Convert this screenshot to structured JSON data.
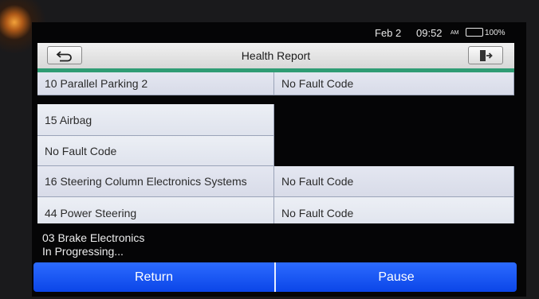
{
  "status_bar": {
    "date": "Feb 2",
    "time": "09:52",
    "ampm": "AM",
    "battery_percent": "100%",
    "battery_level": 1.0
  },
  "header": {
    "title": "Health Report",
    "back_icon": "back-arrow-icon",
    "exit_icon": "exit-door-icon",
    "accent_color": "#2f9c74"
  },
  "report": {
    "row_10": {
      "module": "10 Parallel Parking 2",
      "status": "No Fault Code"
    },
    "row_15": {
      "module": "15 Airbag",
      "status": "No Fault Code"
    },
    "row_16": {
      "module": "16 Steering Column Electronics Systems",
      "status": "No Fault Code"
    },
    "row_44": {
      "module": "44 Power Steering",
      "status": "No Fault Code"
    }
  },
  "progress": {
    "current_module": "03 Brake Electronics",
    "state": "In Progressing..."
  },
  "actions": {
    "return_label": "Return",
    "pause_label": "Pause",
    "button_color": "#1553f0"
  }
}
